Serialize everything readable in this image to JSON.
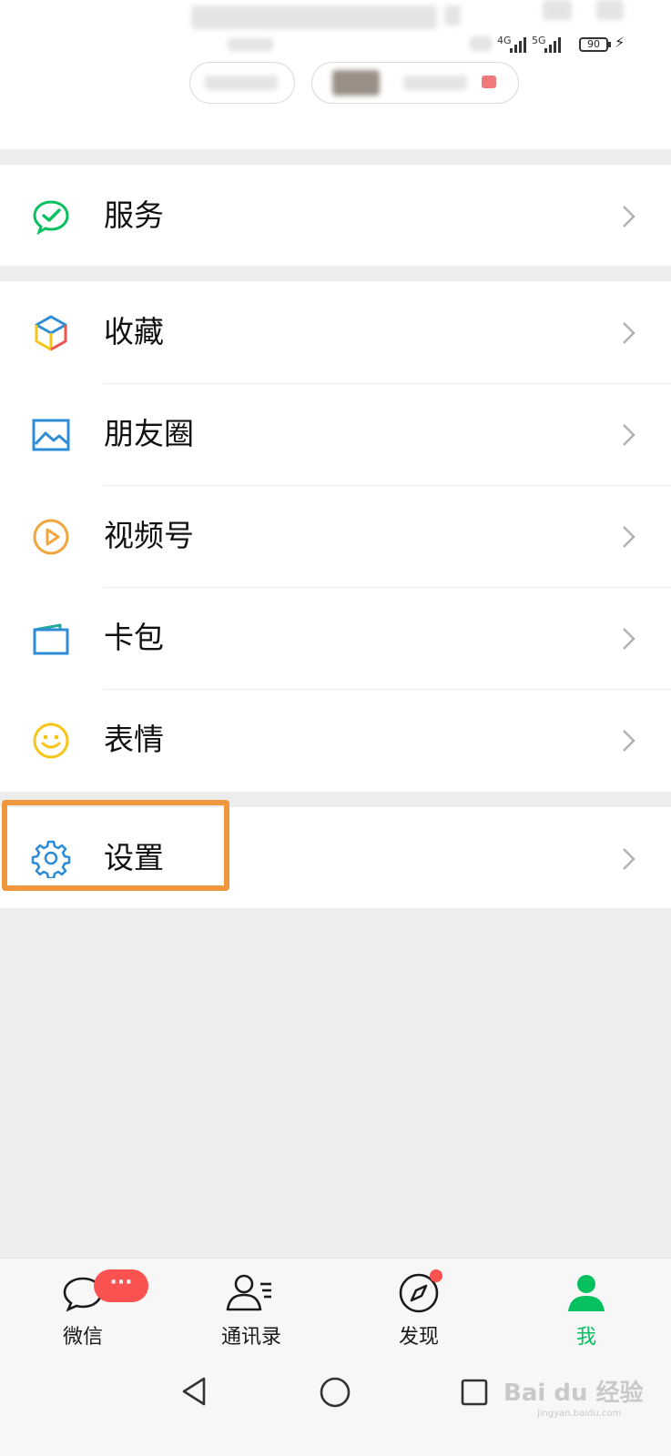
{
  "status_bar": {
    "network_1": "4G",
    "network_2": "5G",
    "battery": "90"
  },
  "menu": {
    "service": "服务",
    "favorites": "收藏",
    "moments": "朋友圈",
    "channels": "视频号",
    "cards": "卡包",
    "stickers": "表情",
    "settings": "设置"
  },
  "tabs": [
    {
      "label": "微信",
      "badge": "···"
    },
    {
      "label": "通讯录"
    },
    {
      "label": "发现"
    },
    {
      "label": "我"
    }
  ],
  "watermark": {
    "text": "Bai du 经验",
    "sub": "jingyan.baidu.com"
  },
  "colors": {
    "accent_green": "#07c160",
    "badge_red": "#fa5151",
    "highlight_orange": "#f0963c",
    "background": "#ededed"
  },
  "icons": {
    "service": "wechat-pay-check-icon",
    "favorites": "cube-icon",
    "moments": "picture-icon",
    "channels": "play-circle-icon",
    "cards": "wallet-icon",
    "stickers": "smiley-icon",
    "settings": "gear-icon"
  }
}
